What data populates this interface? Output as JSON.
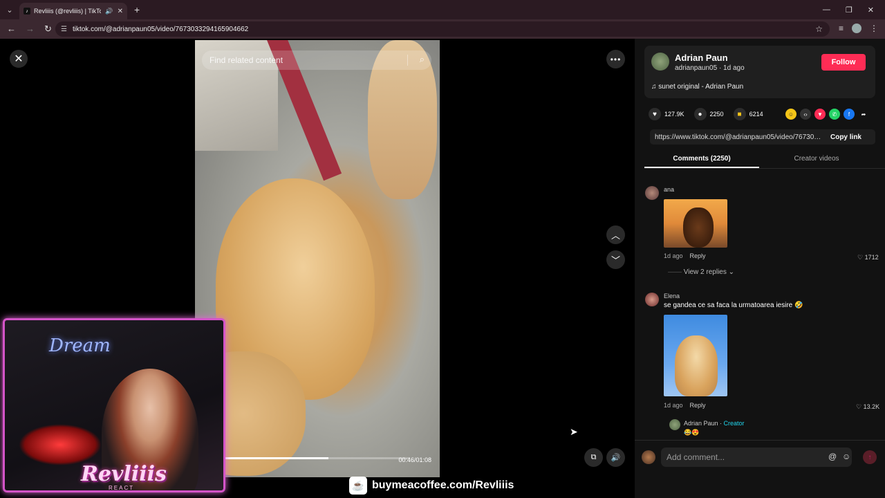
{
  "browser": {
    "tab_title": "Revliiis (@revliiis) | TikTok",
    "url": "tiktok.com/@adrianpaun05/video/7673033294165904662"
  },
  "viewer": {
    "search_placeholder": "Find related content",
    "timecode": "00:46/01:08",
    "progress": 0.56
  },
  "overlay": {
    "neon_sign": "Dream",
    "brand": "Revliiis",
    "brand_sub": "REACT",
    "banner_text": "buymeacoffee.com/Revliiis"
  },
  "author": {
    "name": "Adrian Paun",
    "handle": "adrianpaun05 · 1d ago",
    "follow_label": "Follow",
    "music": "sunet original - Adrian Paun"
  },
  "stats": {
    "likes": "127.9K",
    "comments": "2250",
    "saves": "6214"
  },
  "link": {
    "url": "https://www.tiktok.com/@adrianpaun05/video/767303...",
    "copy_label": "Copy link"
  },
  "tabs": {
    "comments": "Comments (2250)",
    "creator_videos": "Creator videos"
  },
  "comments": [
    {
      "user": "ana",
      "time": "1d ago",
      "reply_label": "Reply",
      "likes": "1712",
      "view_replies": "View 2 replies"
    },
    {
      "user": "Elena",
      "text": "se gandea ce sa faca la urmatoarea iesire 🤣",
      "time": "1d ago",
      "reply_label": "Reply",
      "likes": "13.2K",
      "reply_user": "Adrian Paun",
      "reply_creator": "Creator",
      "reply_text": "😂😍"
    }
  ],
  "composer": {
    "placeholder": "Add comment..."
  }
}
